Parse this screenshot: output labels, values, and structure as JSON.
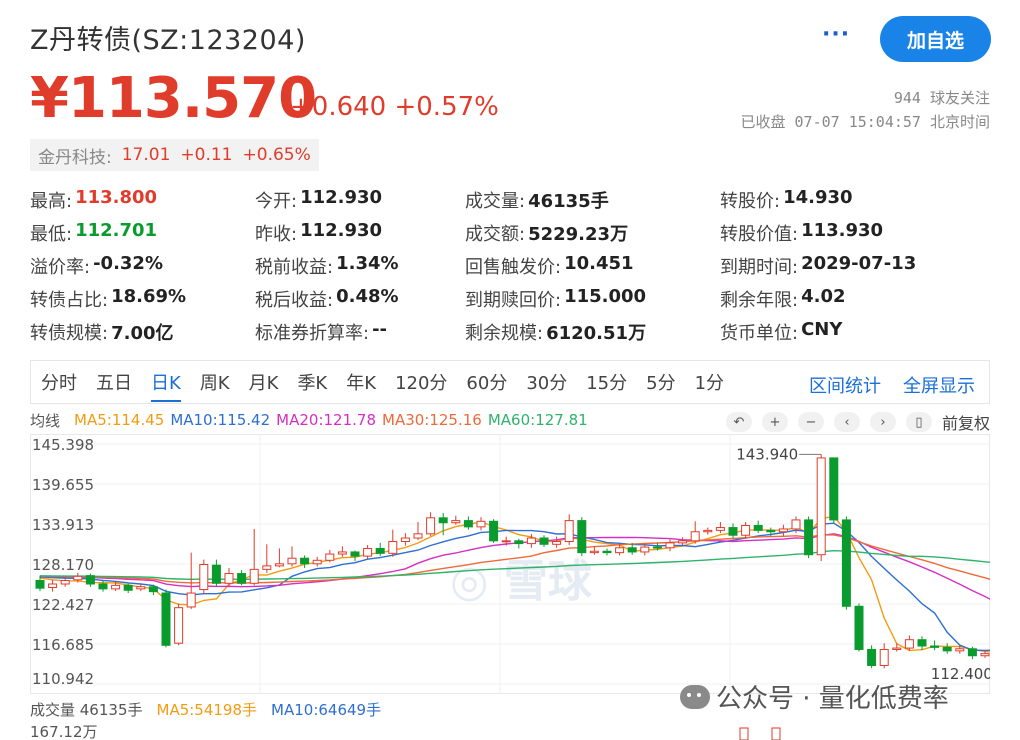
{
  "header": {
    "title": "Z丹转债(SZ:123204)",
    "more": "···",
    "add_button": "加自选",
    "price": "¥113.570",
    "change": "+0.640",
    "change_pct": "+0.57%",
    "fans": "944 球友关注",
    "status": "已收盘 07-07 15:04:57 北京时间"
  },
  "underlying": {
    "name": "金丹科技:",
    "price": "17.01",
    "change": "+0.11",
    "change_pct": "+0.65%"
  },
  "quote": [
    [
      {
        "label": "最高:",
        "value": "113.800",
        "color": "red"
      },
      {
        "label": "今开:",
        "value": "112.930"
      },
      {
        "label": "成交量:",
        "value": "46135手"
      },
      {
        "label": "转股价:",
        "value": "14.930"
      }
    ],
    [
      {
        "label": "最低:",
        "value": "112.701",
        "color": "green"
      },
      {
        "label": "昨收:",
        "value": "112.930"
      },
      {
        "label": "成交额:",
        "value": "5229.23万"
      },
      {
        "label": "转股价值:",
        "value": "113.930"
      }
    ],
    [
      {
        "label": "溢价率:",
        "value": "-0.32%"
      },
      {
        "label": "税前收益:",
        "value": "1.34%"
      },
      {
        "label": "回售触发价:",
        "value": "10.451"
      },
      {
        "label": "到期时间:",
        "value": "2029-07-13"
      }
    ],
    [
      {
        "label": "转债占比:",
        "value": "18.69%"
      },
      {
        "label": "税后收益:",
        "value": "0.48%"
      },
      {
        "label": "到期赎回价:",
        "value": "115.000"
      },
      {
        "label": "剩余年限:",
        "value": "4.02"
      }
    ],
    [
      {
        "label": "转债规模:",
        "value": "7.00亿"
      },
      {
        "label": "标准券折算率:",
        "value": "--"
      },
      {
        "label": "剩余规模:",
        "value": "6120.51万"
      },
      {
        "label": "货币单位:",
        "value": "CNY"
      }
    ]
  ],
  "tabs": [
    "分时",
    "五日",
    "日K",
    "周K",
    "月K",
    "季K",
    "年K",
    "120分",
    "60分",
    "30分",
    "15分",
    "5分",
    "1分"
  ],
  "active_tab": "日K",
  "tab_right": [
    "区间统计",
    "全屏显示"
  ],
  "ma_bar": {
    "label": "均线",
    "items": [
      {
        "text": "MA5:114.45",
        "color": "#f39c12"
      },
      {
        "text": "MA10:115.42",
        "color": "#2e6fd2"
      },
      {
        "text": "MA20:121.78",
        "color": "#d62fc4"
      },
      {
        "text": "MA30:125.16",
        "color": "#ef6a3a"
      },
      {
        "text": "MA60:127.81",
        "color": "#2fb36b"
      }
    ]
  },
  "controls": {
    "icons": [
      "undo-icon",
      "plus-icon",
      "minus-icon",
      "left-icon",
      "right-icon",
      "candle-icon"
    ],
    "adjust": "前复权"
  },
  "volume_bar": {
    "label": "成交量 46135手",
    "ma5": "MA5:54198手",
    "ma10": "MA10:64649手",
    "axis": "167.12万"
  },
  "watermark": {
    "brand": "雪球",
    "wechat": "公众号 · 量化低费率"
  },
  "colors": {
    "up": "#e03c2b",
    "down": "#0a9b2e",
    "accent": "#1a6fd8"
  },
  "chart_data": {
    "type": "candlestick",
    "y_ticks": [
      "145.398",
      "139.655",
      "133.913",
      "128.170",
      "122.427",
      "116.685",
      "110.942"
    ],
    "ylim": [
      110.942,
      145.398
    ],
    "max_label": "143.940",
    "min_label": "112.400",
    "candles": [
      [
        125.8,
        124.7,
        126.5,
        124.3
      ],
      [
        124.8,
        125.3,
        125.9,
        124.2
      ],
      [
        125.3,
        125.8,
        126.3,
        124.9
      ],
      [
        125.9,
        126.4,
        126.9,
        125.5
      ],
      [
        126.5,
        125.3,
        126.8,
        124.9
      ],
      [
        125.3,
        124.6,
        125.8,
        124.2
      ],
      [
        124.6,
        125.1,
        125.6,
        124.3
      ],
      [
        125.1,
        124.4,
        125.4,
        124.0
      ],
      [
        124.6,
        124.9,
        125.3,
        124.3
      ],
      [
        124.9,
        124.2,
        125.2,
        123.7
      ],
      [
        124.0,
        116.5,
        124.5,
        116.2
      ],
      [
        116.8,
        121.9,
        122.5,
        116.5
      ],
      [
        122.0,
        124.0,
        129.8,
        121.7
      ],
      [
        124.5,
        128.1,
        128.8,
        123.9
      ],
      [
        128.0,
        125.4,
        128.8,
        124.9
      ],
      [
        125.4,
        126.8,
        127.6,
        124.9
      ],
      [
        126.8,
        125.4,
        127.3,
        125.1
      ],
      [
        125.4,
        127.4,
        133.2,
        125.1
      ],
      [
        127.4,
        127.9,
        131.0,
        126.9
      ],
      [
        127.9,
        128.2,
        130.4,
        127.7
      ],
      [
        128.2,
        129.0,
        130.7,
        127.8
      ],
      [
        129.0,
        128.2,
        129.4,
        127.6
      ],
      [
        128.2,
        128.7,
        129.2,
        127.8
      ],
      [
        128.7,
        129.6,
        130.2,
        128.4
      ],
      [
        129.6,
        129.9,
        130.7,
        129.2
      ],
      [
        129.9,
        129.3,
        130.1,
        128.6
      ],
      [
        129.3,
        130.4,
        130.9,
        128.9
      ],
      [
        130.4,
        129.7,
        131.2,
        129.3
      ],
      [
        129.7,
        131.4,
        133.1,
        129.2
      ],
      [
        131.4,
        131.9,
        132.6,
        130.8
      ],
      [
        131.9,
        132.5,
        134.2,
        131.6
      ],
      [
        132.5,
        134.8,
        135.6,
        132.2
      ],
      [
        134.8,
        134.1,
        135.5,
        132.3
      ],
      [
        134.1,
        134.4,
        135.1,
        133.8
      ],
      [
        134.4,
        133.5,
        135.0,
        133.1
      ],
      [
        133.5,
        134.3,
        134.9,
        133.0
      ],
      [
        134.3,
        131.5,
        134.6,
        131.2
      ],
      [
        131.5,
        131.5,
        132.1,
        130.8
      ],
      [
        131.5,
        131.1,
        131.8,
        130.4
      ],
      [
        131.1,
        131.9,
        132.5,
        130.5
      ],
      [
        131.9,
        131.0,
        132.3,
        130.6
      ],
      [
        131.0,
        131.4,
        132.1,
        130.5
      ],
      [
        131.4,
        134.4,
        135.3,
        130.9
      ],
      [
        134.4,
        129.8,
        134.9,
        129.3
      ],
      [
        129.8,
        130.0,
        130.7,
        129.5
      ],
      [
        130.0,
        129.8,
        130.4,
        129.4
      ],
      [
        129.8,
        130.5,
        131.0,
        129.4
      ],
      [
        130.5,
        129.9,
        131.2,
        129.5
      ],
      [
        129.9,
        130.6,
        131.1,
        129.4
      ],
      [
        130.6,
        130.5,
        131.2,
        130.1
      ],
      [
        130.5,
        131.2,
        131.7,
        130.0
      ],
      [
        131.2,
        131.5,
        132.0,
        130.9
      ],
      [
        131.5,
        132.8,
        134.3,
        131.1
      ],
      [
        132.8,
        133.0,
        133.4,
        132.4
      ],
      [
        133.0,
        133.4,
        134.2,
        132.6
      ],
      [
        133.4,
        132.3,
        134.0,
        131.9
      ],
      [
        132.3,
        133.7,
        134.2,
        131.8
      ],
      [
        133.7,
        133.0,
        134.4,
        132.6
      ],
      [
        133.0,
        132.8,
        133.4,
        132.2
      ],
      [
        132.8,
        133.2,
        133.8,
        132.2
      ],
      [
        133.2,
        134.5,
        135.0,
        132.6
      ],
      [
        134.5,
        129.5,
        135.0,
        129.0
      ],
      [
        129.5,
        143.4,
        143.9,
        128.6
      ],
      [
        143.4,
        134.5,
        143.0,
        134.0
      ],
      [
        134.5,
        122.1,
        135.0,
        121.6
      ],
      [
        122.1,
        115.9,
        122.5,
        115.6
      ],
      [
        115.9,
        113.6,
        116.5,
        113.2
      ],
      [
        113.6,
        115.9,
        116.8,
        113.2
      ],
      [
        115.9,
        116.1,
        116.8,
        115.6
      ],
      [
        116.1,
        117.3,
        117.9,
        115.7
      ],
      [
        117.3,
        116.4,
        117.8,
        115.8
      ],
      [
        116.4,
        116.2,
        117.2,
        115.8
      ],
      [
        116.2,
        115.7,
        116.8,
        115.3
      ],
      [
        115.7,
        116.0,
        116.5,
        115.3
      ],
      [
        116.0,
        115.0,
        116.3,
        114.5
      ],
      [
        115.0,
        115.3,
        115.8,
        114.7
      ],
      [
        115.3,
        114.8,
        115.7,
        114.3
      ],
      [
        114.8,
        115.1,
        115.6,
        114.6
      ],
      [
        115.1,
        112.9,
        115.4,
        112.4
      ],
      [
        112.9,
        113.6,
        113.8,
        112.7
      ]
    ]
  }
}
